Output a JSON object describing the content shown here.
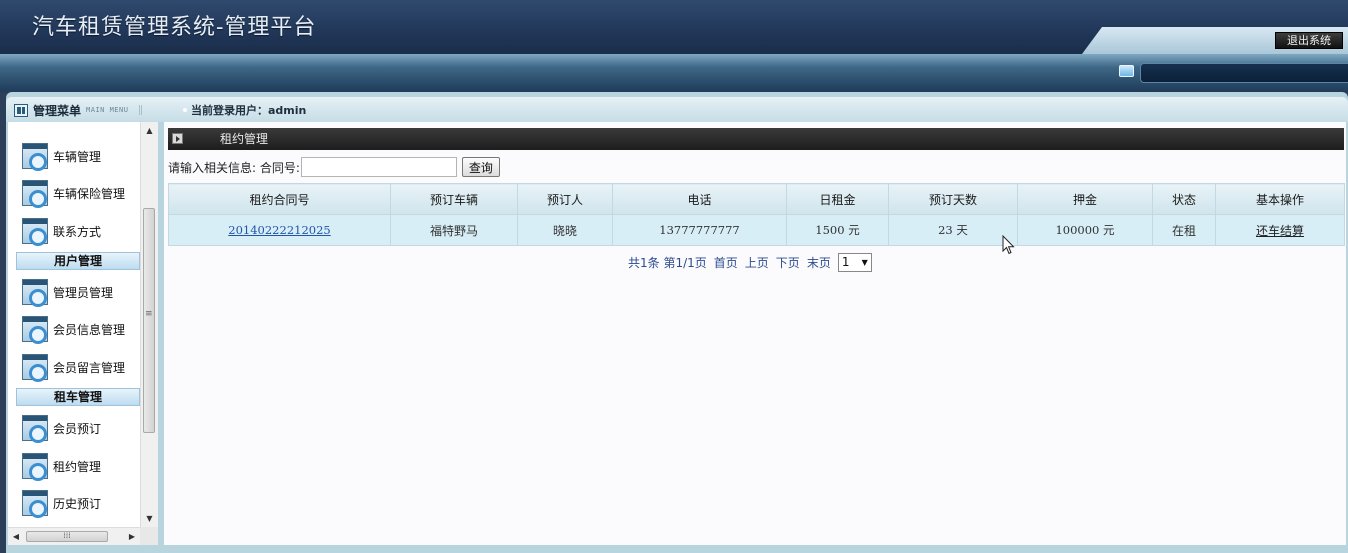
{
  "banner": {
    "title": "汽车租赁管理系统-管理平台",
    "logout_label": "退出系统"
  },
  "header": {
    "menu_title": "管理菜单",
    "menu_subtitle": "MAIN MENU",
    "login_label": "当前登录用户：admin"
  },
  "sidebar": {
    "items": [
      {
        "label": "车辆管理"
      },
      {
        "label": "车辆保险管理"
      },
      {
        "label": "联系方式"
      },
      {
        "group": "用户管理"
      },
      {
        "label": "管理员管理"
      },
      {
        "label": "会员信息管理"
      },
      {
        "label": "会员留言管理"
      },
      {
        "group": "租车管理"
      },
      {
        "label": "会员预订"
      },
      {
        "label": "租约管理"
      },
      {
        "label": "历史预订"
      }
    ]
  },
  "main": {
    "section_title": "租约管理",
    "search": {
      "prompt": "请输入相关信息: 合同号:",
      "value": "",
      "button_label": "查询"
    },
    "table": {
      "columns": [
        "租约合同号",
        "预订车辆",
        "预订人",
        "电话",
        "日租金",
        "预订天数",
        "押金",
        "状态",
        "基本操作"
      ],
      "rows": [
        {
          "contract_no": "20140222212025",
          "car": "福特野马",
          "renter": "晓晓",
          "phone": "13777777777",
          "daily_rent": "1500 元",
          "days": "23 天",
          "deposit": "100000 元",
          "status": "在租",
          "action": "还车结算"
        }
      ]
    },
    "pager": {
      "summary": "共1条 第1/1页",
      "first": "首页",
      "prev": "上页",
      "next": "下页",
      "last": "末页",
      "selected_page": "1"
    }
  },
  "colors": {
    "banner": "#22385a",
    "frame": "#b8d4de",
    "row_bg": "#d7eef7",
    "link": "#2255a8"
  }
}
